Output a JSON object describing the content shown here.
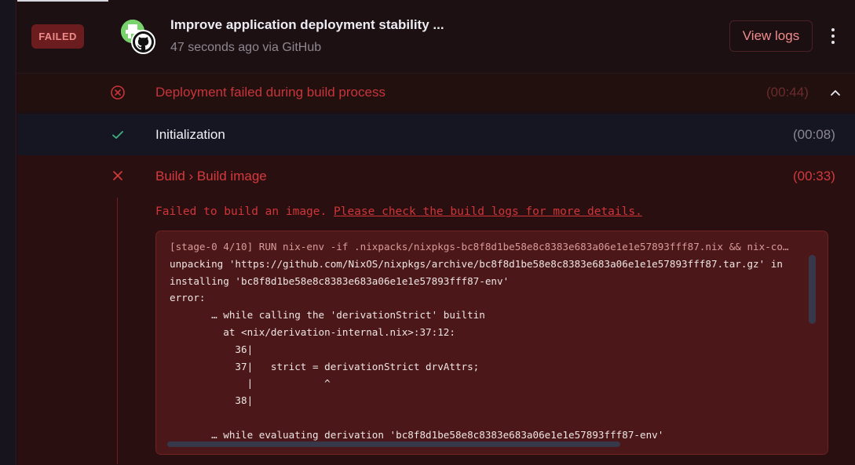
{
  "deployment": {
    "status_badge": "FAILED",
    "commit_title": "Improve application deployment stability ...",
    "commit_subtitle": "47 seconds ago via GitHub",
    "view_logs_label": "View logs"
  },
  "summary": {
    "text": "Deployment failed during build process",
    "duration": "(00:44)"
  },
  "steps": {
    "initialization": {
      "label": "Initialization",
      "duration": "(00:08)"
    },
    "build": {
      "label": "Build › Build image",
      "duration": "(00:33)",
      "error_prefix": "Failed to build an image. ",
      "error_link": "Please check the build logs for more details."
    }
  },
  "log_lines": [
    "[stage-0 4/10] RUN nix-env -if .nixpacks/nixpkgs-bc8f8d1be58e8c8383e683a06e1e1e57893fff87.nix && nix-co…",
    "unpacking 'https://github.com/NixOS/nixpkgs/archive/bc8f8d1be58e8c8383e683a06e1e1e57893fff87.tar.gz' in",
    "installing 'bc8f8d1be58e8c8383e683a06e1e1e57893fff87-env'",
    "error:",
    "       … while calling the 'derivationStrict' builtin",
    "         at <nix/derivation-internal.nix>:37:12:",
    "           36|",
    "           37|   strict = derivationStrict drvAttrs;",
    "             |            ^",
    "           38|",
    "",
    "       … while evaluating derivation 'bc8f8d1be58e8c8383e683a06e1e1e57893fff87-env'"
  ],
  "colors": {
    "accent_red": "#d63a3e",
    "success_green": "#3fb37f",
    "badge_bg": "#6a1c1e"
  },
  "icons": {
    "summary": "x-circle-icon",
    "initialization": "check-icon",
    "build": "x-icon",
    "collapse": "chevron-up-icon",
    "more": "more-vertical-icon",
    "source": "github-icon"
  }
}
